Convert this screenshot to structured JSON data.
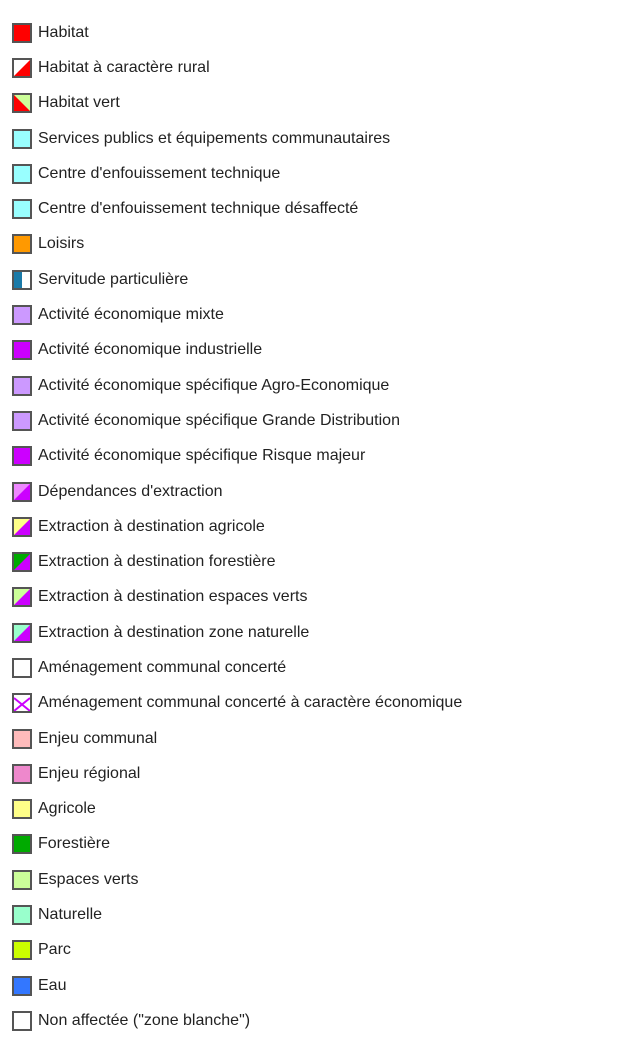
{
  "legend": {
    "items": [
      {
        "label": "Habitat",
        "style": "solid",
        "color": "#ff0000"
      },
      {
        "label": "Habitat à caractère rural",
        "style": "diag-br",
        "color": "#ff0000",
        "color2": "#ffffff"
      },
      {
        "label": "Habitat vert",
        "style": "diag-bl",
        "color": "#ff0000",
        "color2": "#ccff99"
      },
      {
        "label": "Services publics et équipements communautaires",
        "style": "solid",
        "color": "#99ffff"
      },
      {
        "label": "Centre d'enfouissement technique",
        "style": "solid",
        "color": "#99ffff"
      },
      {
        "label": "Centre d'enfouissement technique désaffecté",
        "style": "solid",
        "color": "#99ffff"
      },
      {
        "label": "Loisirs",
        "style": "solid",
        "color": "#ff9900"
      },
      {
        "label": "Servitude particulière",
        "style": "split-v",
        "color": "#1a7aa8",
        "color2": "#ffffff"
      },
      {
        "label": "Activité économique mixte",
        "style": "solid",
        "color": "#cc99ff"
      },
      {
        "label": "Activité économique industrielle",
        "style": "solid",
        "color": "#cc00ff"
      },
      {
        "label": "Activité économique spécifique Agro-Economique",
        "style": "solid",
        "color": "#cc99ff"
      },
      {
        "label": "Activité économique spécifique Grande Distribution",
        "style": "solid",
        "color": "#cc99ff"
      },
      {
        "label": "Activité économique spécifique Risque majeur",
        "style": "solid",
        "color": "#cc00ff"
      },
      {
        "label": "Dépendances d'extraction",
        "style": "diag-br",
        "color": "#cc00ff",
        "color2": "#ee88ff"
      },
      {
        "label": "Extraction à destination agricole",
        "style": "diag-br",
        "color": "#cc00ff",
        "color2": "#ffff88"
      },
      {
        "label": "Extraction à destination forestière",
        "style": "diag-br",
        "color": "#cc00ff",
        "color2": "#00aa00"
      },
      {
        "label": "Extraction à destination espaces verts",
        "style": "diag-br",
        "color": "#cc00ff",
        "color2": "#ccff99"
      },
      {
        "label": "Extraction à destination zone naturelle",
        "style": "diag-br",
        "color": "#cc00ff",
        "color2": "#99ffcc"
      },
      {
        "label": "Aménagement communal concerté",
        "style": "solid",
        "color": "#ffffff"
      },
      {
        "label": "Aménagement communal concerté à caractère économique",
        "style": "cross",
        "color": "#cc00ff",
        "color2": "#ffffff"
      },
      {
        "label": "Enjeu communal",
        "style": "solid",
        "color": "#ffbbbb"
      },
      {
        "label": "Enjeu régional",
        "style": "solid",
        "color": "#ee88cc"
      },
      {
        "label": "Agricole",
        "style": "solid",
        "color": "#ffff88"
      },
      {
        "label": "Forestière",
        "style": "solid",
        "color": "#00aa00"
      },
      {
        "label": "Espaces verts",
        "style": "solid",
        "color": "#ccff99"
      },
      {
        "label": "Naturelle",
        "style": "solid",
        "color": "#99ffcc"
      },
      {
        "label": "Parc",
        "style": "solid",
        "color": "#ccff00"
      },
      {
        "label": "Eau",
        "style": "solid",
        "color": "#3377ff"
      },
      {
        "label": "Non affectée  (\"zone blanche\")",
        "style": "solid",
        "color": "#ffffff"
      }
    ]
  }
}
